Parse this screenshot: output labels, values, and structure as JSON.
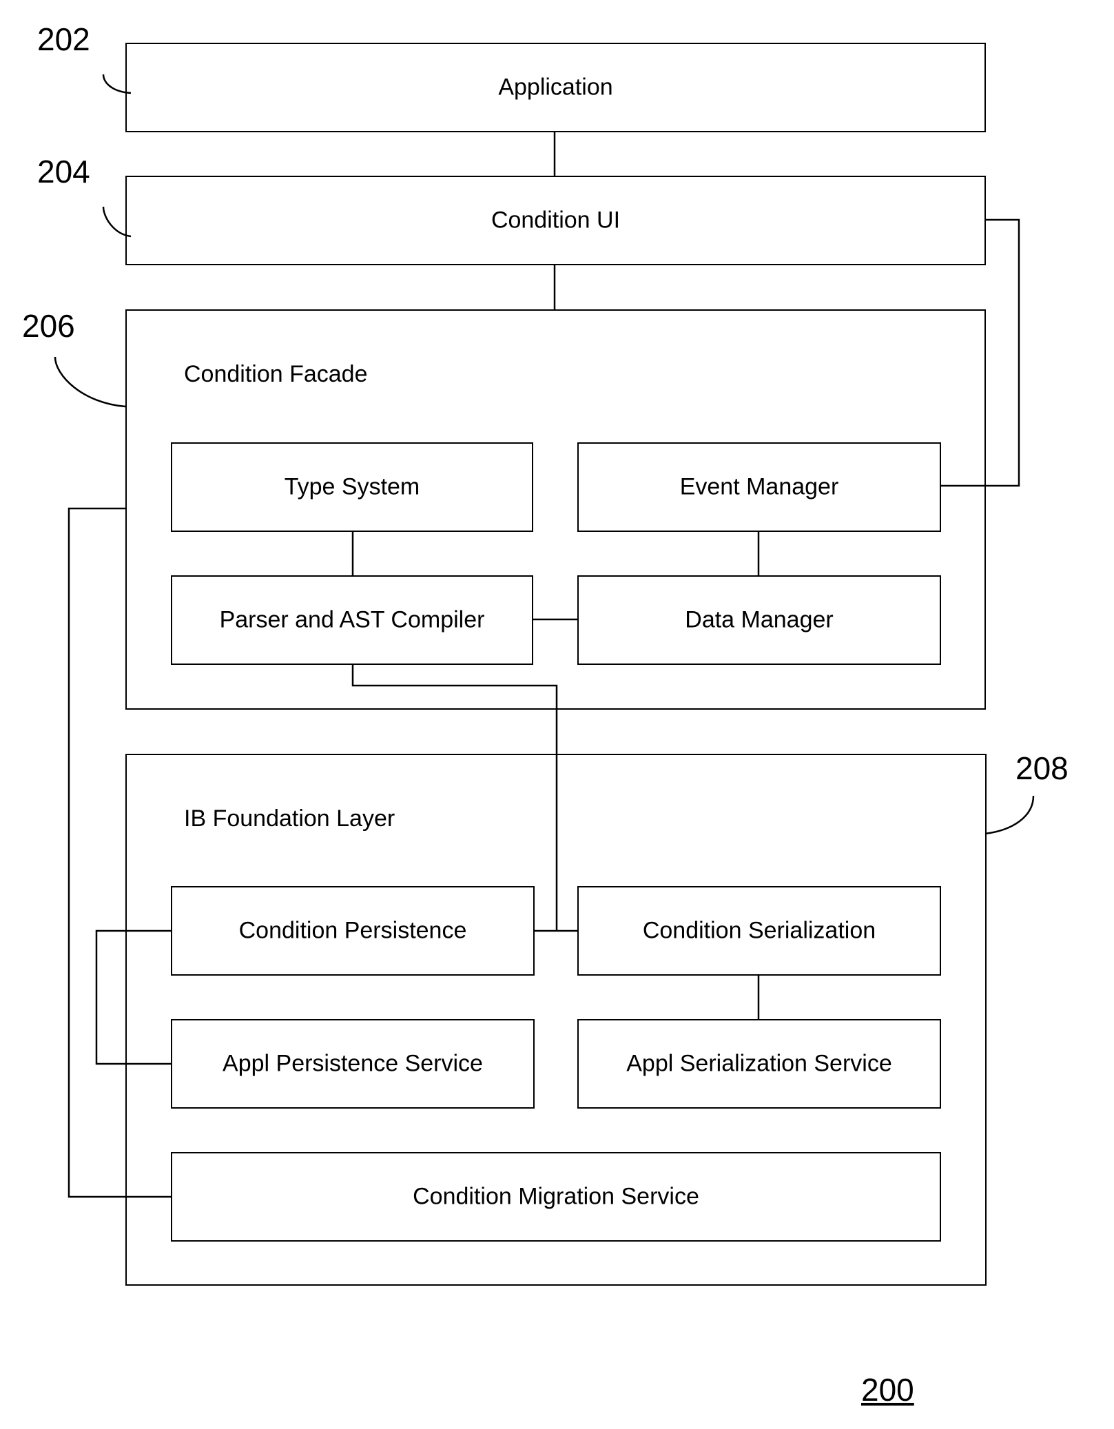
{
  "figure": {
    "number": "200",
    "blocks": {
      "application": {
        "ref": "202",
        "label": "Application"
      },
      "condition_ui": {
        "ref": "204",
        "label": "Condition UI"
      },
      "condition_facade": {
        "ref": "206",
        "label": "Condition Facade",
        "children": {
          "type_system": "Type System",
          "event_manager": "Event Manager",
          "parser_ast_compiler": "Parser and AST Compiler",
          "data_manager": "Data Manager"
        }
      },
      "ib_foundation_layer": {
        "ref": "208",
        "label": "IB Foundation Layer",
        "children": {
          "condition_persistence": "Condition Persistence",
          "condition_serialization": "Condition Serialization",
          "appl_persistence_service": "Appl Persistence Service",
          "appl_serialization_service": "Appl Serialization Service",
          "condition_migration_service": "Condition Migration Service"
        }
      }
    },
    "connections": [
      [
        "Application",
        "Condition UI"
      ],
      [
        "Condition UI",
        "Condition Facade"
      ],
      [
        "Condition UI",
        "Event Manager"
      ],
      [
        "Type System",
        "Parser and AST Compiler"
      ],
      [
        "Event Manager",
        "Data Manager"
      ],
      [
        "Parser and AST Compiler",
        "Data Manager"
      ],
      [
        "Parser and AST Compiler",
        "Condition Persistence"
      ],
      [
        "Condition Persistence",
        "Condition Serialization"
      ],
      [
        "Condition Persistence",
        "Appl Persistence Service"
      ],
      [
        "Condition Serialization",
        "Appl Serialization Service"
      ],
      [
        "Condition Facade",
        "Condition Migration Service"
      ]
    ]
  }
}
